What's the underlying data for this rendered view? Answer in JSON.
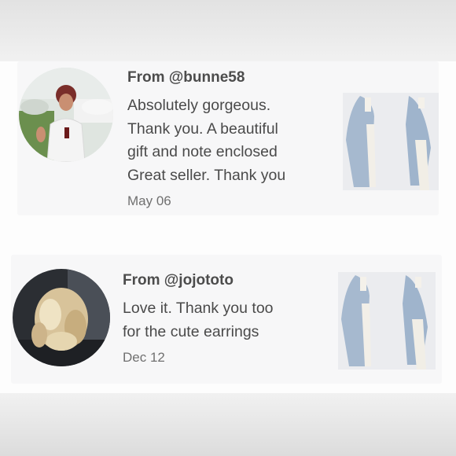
{
  "reviews": [
    {
      "from": "From @bunne58",
      "lines": [
        "Absolutely gorgeous.",
        "Thank you. A beautiful",
        "gift and note enclosed",
        "Great seller. Thank you"
      ],
      "date": "May 06",
      "avatar_icon": "reviewer-photo",
      "thumb_icon": "product-photo"
    },
    {
      "from": "From @jojototo",
      "lines": [
        "Love it. Thank you too",
        "for the cute earrings"
      ],
      "date": "Dec 12",
      "avatar_icon": "reviewer-photo",
      "thumb_icon": "product-photo"
    }
  ],
  "colors": {
    "card_bg": "#f7f7f8",
    "text": "#4a4a4a",
    "date_text": "#707070",
    "product_blue": "#9fb4cc"
  }
}
